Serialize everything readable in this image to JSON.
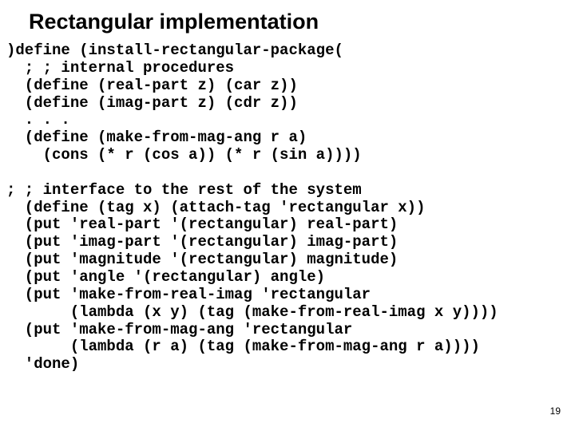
{
  "title": "Rectangular implementation",
  "code": ")define (install-rectangular-package(\n  ; ; internal procedures\n  (define (real-part z) (car z))\n  (define (imag-part z) (cdr z))\n  . . .\n  (define (make-from-mag-ang r a)\n    (cons (* r (cos a)) (* r (sin a))))\n\n; ; interface to the rest of the system\n  (define (tag x) (attach-tag 'rectangular x))\n  (put 'real-part '(rectangular) real-part)\n  (put 'imag-part '(rectangular) imag-part)\n  (put 'magnitude '(rectangular) magnitude)\n  (put 'angle '(rectangular) angle)\n  (put 'make-from-real-imag 'rectangular\n       (lambda (x y) (tag (make-from-real-imag x y))))\n  (put 'make-from-mag-ang 'rectangular\n       (lambda (r a) (tag (make-from-mag-ang r a))))\n  'done)",
  "page_number": "19"
}
